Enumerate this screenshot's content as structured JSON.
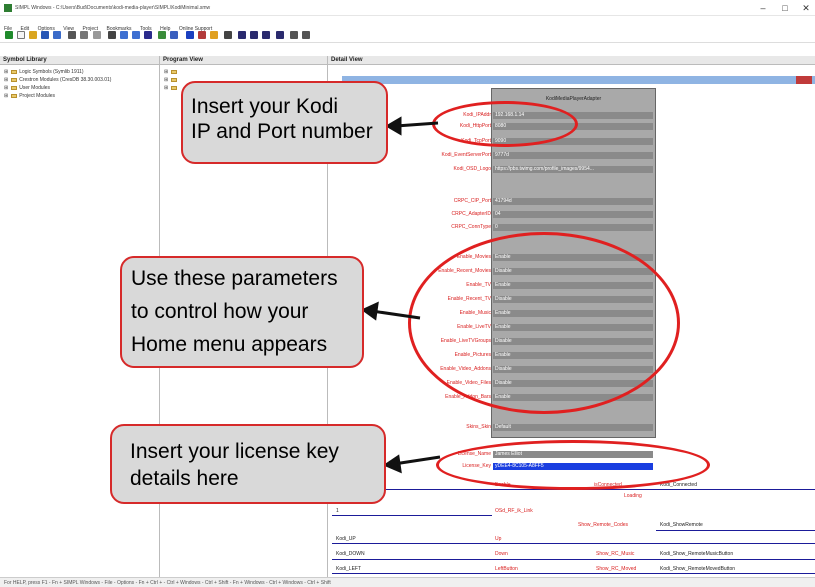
{
  "window": {
    "title": "SIMPL Windows - C:\\Users\\Bud\\Documents\\kodi-media-player\\SIMPL\\KodiMinimal.smw",
    "minimize": "–",
    "maximize": "□",
    "close": "✕"
  },
  "menu": [
    "File",
    "Edit",
    "Options",
    "View",
    "Project",
    "Bookmarks",
    "Tools",
    "Help",
    "Online Support"
  ],
  "panes": {
    "symbol_library": "Symbol Library",
    "program_view": "Program View",
    "detail_view": "Detail View"
  },
  "symbol_tree": [
    "Logic Symbols (Symlib 1911)",
    "Crestron Modules (CresDB 38.30.003.01)",
    "User Modules",
    "Project Modules"
  ],
  "module": {
    "title": "KodiMediaPlayerAdapter",
    "params": [
      {
        "label": "Kodi_IPAddr",
        "value": "192.168.1.14"
      },
      {
        "label": "Kodi_HttpPort",
        "value": "8080"
      },
      {
        "label": "Kodi_TcpPort",
        "value": "9090"
      },
      {
        "label": "Kodi_EventServerPort",
        "value": "9777d"
      },
      {
        "label": "Kodi_OSD_Logo",
        "value": "https://pbs.twimg.com/profile_images/9954..."
      },
      {
        "label": "CRPC_CIP_Port",
        "value": "41794d"
      },
      {
        "label": "CRPC_AdapterID",
        "value": "04"
      },
      {
        "label": "CRPC_ConnType",
        "value": "0"
      },
      {
        "label": "Enable_Movies",
        "value": "Enable"
      },
      {
        "label": "Enable_Recent_Movies",
        "value": "Disable"
      },
      {
        "label": "Enable_TV",
        "value": "Enable"
      },
      {
        "label": "Enable_Recent_TV",
        "value": "Disable"
      },
      {
        "label": "Enable_Music",
        "value": "Enable"
      },
      {
        "label": "Enable_LiveTV",
        "value": "Enable"
      },
      {
        "label": "Enable_LiveTVGroups",
        "value": "Disable"
      },
      {
        "label": "Enable_Pictures",
        "value": "Enable"
      },
      {
        "label": "Enable_Video_Addons",
        "value": "Disable"
      },
      {
        "label": "Enable_Video_Files",
        "value": "Disable"
      },
      {
        "label": "Enable_Addon_Bars",
        "value": "Enable"
      },
      {
        "label": "Skins_Skin",
        "value": "Default"
      },
      {
        "label": "License_Name",
        "value": "James Elliot"
      },
      {
        "label": "License_Key",
        "value": "yDEE4-8C105-A8FF5"
      }
    ]
  },
  "signals": {
    "enable": "Enable",
    "is_connected": "isConnected",
    "connected": "Kodi_Connected",
    "loading": "Loading",
    "one": "1",
    "osd_rf_ir_link": "OSd_RF_ik_Link",
    "show_remote_codes": "Show_Remote_Codes",
    "show_remote_out": "Kodi_ShowRemote",
    "kodi_up": "Kodi_UP",
    "up": "Up",
    "kodi_down": "Kodi_DOWN",
    "down": "Down",
    "show_rc_music": "Show_RC_Music",
    "show_remote_music": "Kodi_Show_RemoteMusicButton",
    "kodi_left": "Kodi_LEFT",
    "left": "LeftButton",
    "show_rc_moved": "Show_RC_Moved",
    "show_remote_moved": "Kodi_Show_RemoteMovedButton"
  },
  "callouts": {
    "ip": [
      "Insert your Kodi",
      "IP and Port number"
    ],
    "home": [
      "Use these parameters",
      "to control how your",
      "Home menu appears"
    ],
    "license": [
      "Insert your license key",
      "details here"
    ]
  },
  "status": "For HELP, press F1 - Fn + SIMPL Windows - File - Options - Fn + Ctrl + - Ctrl + Windows - Ctrl + Shift - Fn + Windows - Ctrl + Windows - Ctrl + Shift"
}
